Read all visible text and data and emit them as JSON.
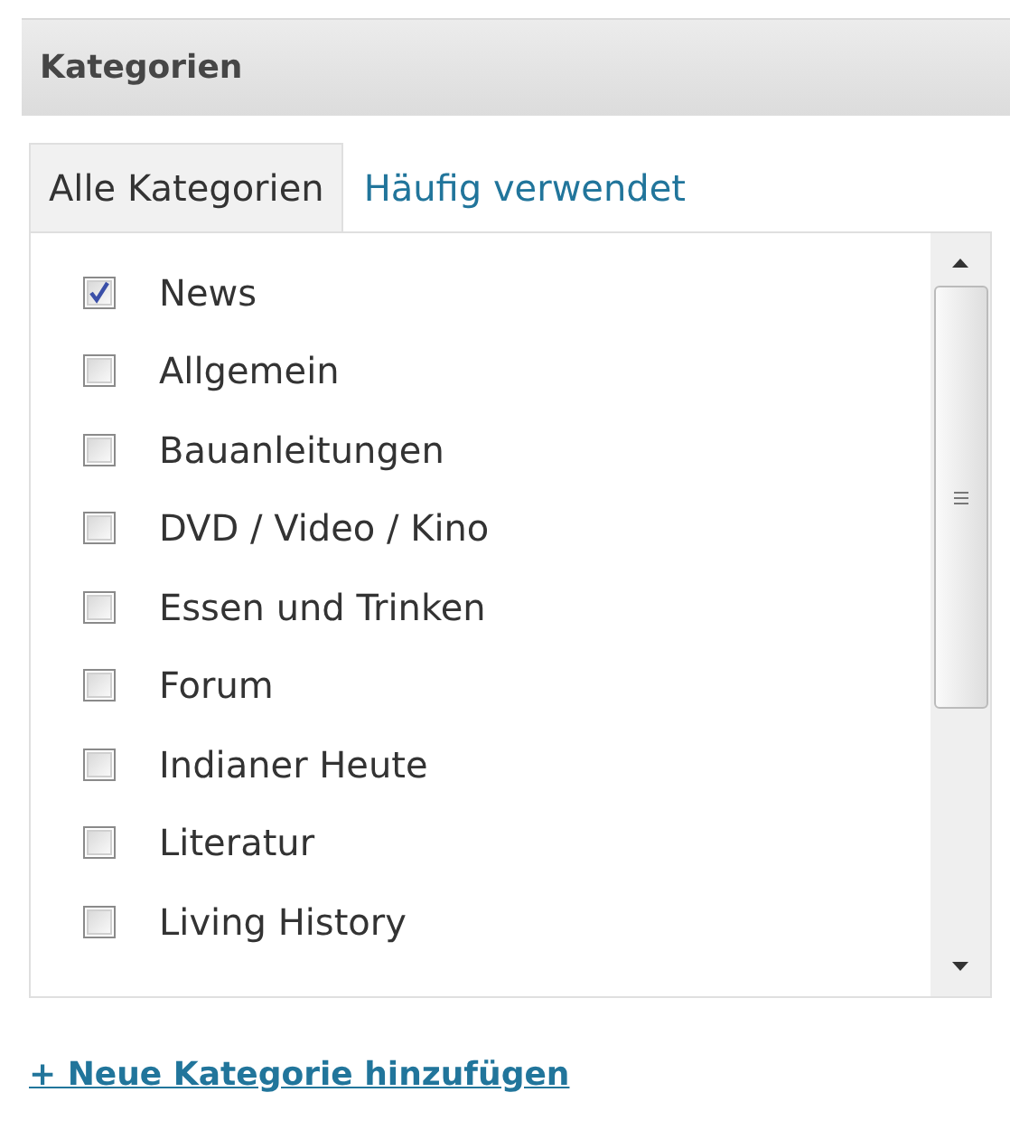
{
  "panel": {
    "title": "Kategorien"
  },
  "tabs": [
    {
      "label": "Alle Kategorien",
      "selected": true
    },
    {
      "label": "Häufig verwendet",
      "selected": false
    }
  ],
  "categories": [
    {
      "label": "News",
      "checked": true
    },
    {
      "label": "Allgemein",
      "checked": false
    },
    {
      "label": "Bauanleitungen",
      "checked": false
    },
    {
      "label": "DVD / Video / Kino",
      "checked": false
    },
    {
      "label": "Essen und Trinken",
      "checked": false
    },
    {
      "label": "Forum",
      "checked": false
    },
    {
      "label": "Indianer Heute",
      "checked": false
    },
    {
      "label": "Literatur",
      "checked": false
    },
    {
      "label": "Living History",
      "checked": false
    }
  ],
  "add_link": "+ Neue Kategorie hinzufügen"
}
